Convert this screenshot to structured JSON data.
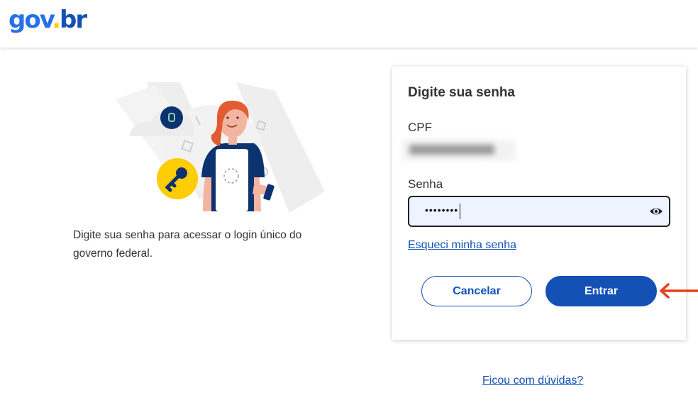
{
  "header": {
    "logo_part1": "gov",
    "logo_part2": ".",
    "logo_part3": "br"
  },
  "intro": {
    "description": "Digite sua senha para acessar o login único do governo federal."
  },
  "login": {
    "title": "Digite sua senha",
    "cpf_label": "CPF",
    "password_label": "Senha",
    "password_value": "••••••••",
    "forgot_link": "Esqueci minha senha",
    "cancel_label": "Cancelar",
    "enter_label": "Entrar"
  },
  "footer": {
    "help_link": "Ficou com dúvidas?"
  },
  "colors": {
    "primary": "#1351b4",
    "logo_blue": "#2670e8",
    "logo_yellow": "#ffcd07",
    "input_bg": "#edf3ff",
    "arrow": "#e8401c"
  },
  "icons": {
    "password_toggle": "eye-icon",
    "illustration_key": "key-icon",
    "illustration_lock": "lock-icon"
  }
}
